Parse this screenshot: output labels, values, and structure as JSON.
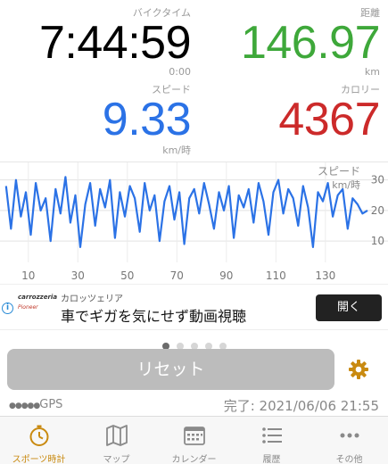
{
  "stats": {
    "time": {
      "label": "バイクタイム",
      "value": "7:44:59",
      "sub": "0:00",
      "color": "#000000"
    },
    "distance": {
      "label": "距離",
      "value": "146.97",
      "sub": "km",
      "color": "#3ea83a"
    },
    "speed": {
      "label": "スピード",
      "value": "9.33",
      "sub": "km/時",
      "color": "#2b72e6"
    },
    "calories": {
      "label": "カロリー",
      "value": "4367",
      "sub": "",
      "color": "#cc2a2a"
    }
  },
  "chart_data": {
    "type": "line",
    "title": "スピード",
    "ylabel": "km/時",
    "x_ticks": [
      "10",
      "30",
      "50",
      "70",
      "90",
      "110",
      "130"
    ],
    "y_ticks": [
      "10",
      "20",
      "30"
    ],
    "xlim": [
      0,
      147
    ],
    "ylim": [
      3,
      34
    ],
    "series": [
      {
        "color": "#2b72e6",
        "x": [
          1,
          3,
          5,
          7,
          9,
          11,
          13,
          15,
          17,
          19,
          21,
          23,
          25,
          27,
          29,
          31,
          33,
          35,
          37,
          39,
          41,
          43,
          45,
          47,
          49,
          51,
          53,
          55,
          57,
          59,
          61,
          63,
          65,
          67,
          69,
          71,
          73,
          75,
          77,
          79,
          81,
          83,
          85,
          87,
          89,
          91,
          93,
          95,
          97,
          99,
          101,
          103,
          105,
          107,
          109,
          111,
          113,
          115,
          117,
          119,
          121,
          123,
          125,
          127,
          129,
          131,
          133,
          135,
          137,
          139,
          141,
          143,
          145,
          147
        ],
        "values": [
          28,
          14,
          30,
          18,
          26,
          12,
          29,
          20,
          24,
          10,
          27,
          19,
          31,
          16,
          25,
          8,
          22,
          29,
          15,
          27,
          21,
          30,
          11,
          26,
          18,
          28,
          24,
          13,
          29,
          20,
          25,
          10,
          23,
          28,
          17,
          26,
          9,
          24,
          27,
          19,
          29,
          22,
          14,
          26,
          20,
          28,
          11,
          25,
          21,
          27,
          16,
          29,
          23,
          12,
          26,
          30,
          19,
          27,
          24,
          15,
          28,
          21,
          8,
          26,
          23,
          29,
          18,
          25,
          27,
          14,
          24,
          22,
          19,
          20
        ]
      }
    ]
  },
  "ad": {
    "brand_line1": "carrozzeria",
    "brand_line2": "Pioneer",
    "title": "カロッツェリア",
    "headline": "車でギガを気にせず動画視聴",
    "button": "開く",
    "info_icon": "info-icon"
  },
  "pager": {
    "count": 5,
    "active": 0
  },
  "reset_label": "リセット",
  "status": {
    "gps_bars": "●●●●●",
    "gps_label": "GPS",
    "completed": "完了: 2021/06/06 21:55"
  },
  "tabs": [
    {
      "label": "スポーツ時計",
      "icon": "stopwatch-icon",
      "active": true
    },
    {
      "label": "マップ",
      "icon": "map-icon",
      "active": false
    },
    {
      "label": "カレンダー",
      "icon": "calendar-icon",
      "active": false
    },
    {
      "label": "履歴",
      "icon": "list-icon",
      "active": false
    },
    {
      "label": "その他",
      "icon": "more-icon",
      "active": false
    }
  ],
  "colors": {
    "accent": "#c98a10",
    "reset_bg": "#bcbcbc"
  }
}
